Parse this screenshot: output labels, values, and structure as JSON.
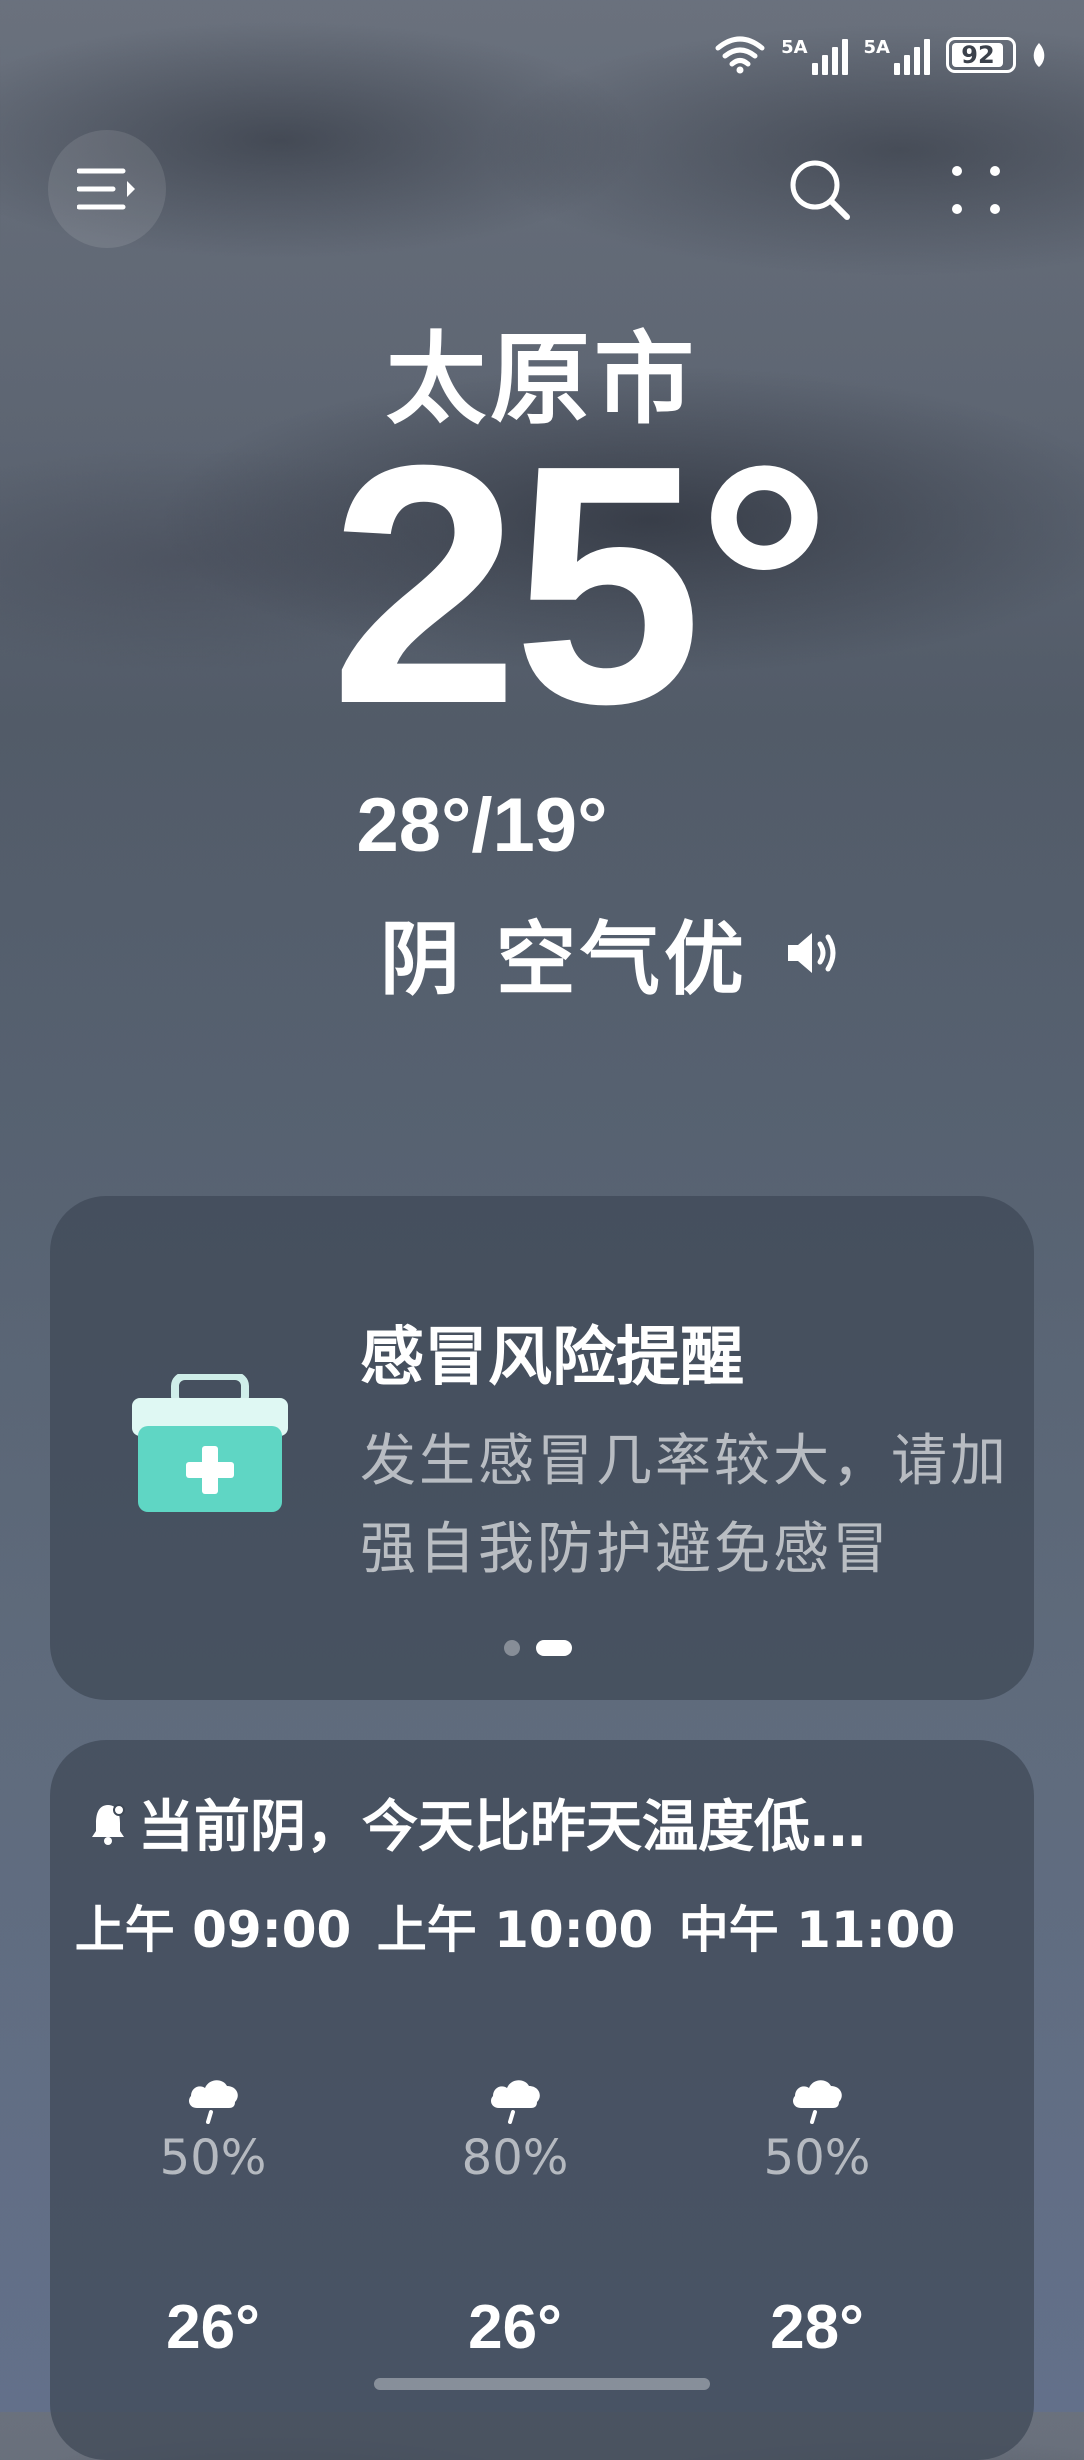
{
  "status_bar": {
    "network1": "5A",
    "network2": "5A",
    "battery": "92"
  },
  "header": {
    "city": "太原市",
    "current_temp": "25°",
    "range": "28°/19°",
    "condition": "阴 空气优"
  },
  "health_card": {
    "title": "感冒风险提醒",
    "message": "发生感冒几率较大，请加强自我防护避免感冒",
    "page_count": 2,
    "active_page": 2
  },
  "forecast_card": {
    "title": "当前阴，今天比昨天温度低…",
    "hours": [
      {
        "time": "上午 09:00",
        "precip": "50%",
        "temp": "26°",
        "icon": "rain-cloud-icon"
      },
      {
        "time": "上午 10:00",
        "precip": "80%",
        "temp": "26°",
        "icon": "rain-cloud-icon"
      },
      {
        "time": "中午 11:00",
        "precip": "50%",
        "temp": "28°",
        "icon": "rain-cloud-icon"
      }
    ]
  },
  "colors": {
    "card_bg": "#3e4856",
    "kit_teal": "#5fd6c4",
    "text_muted": "#b9bfc8"
  }
}
